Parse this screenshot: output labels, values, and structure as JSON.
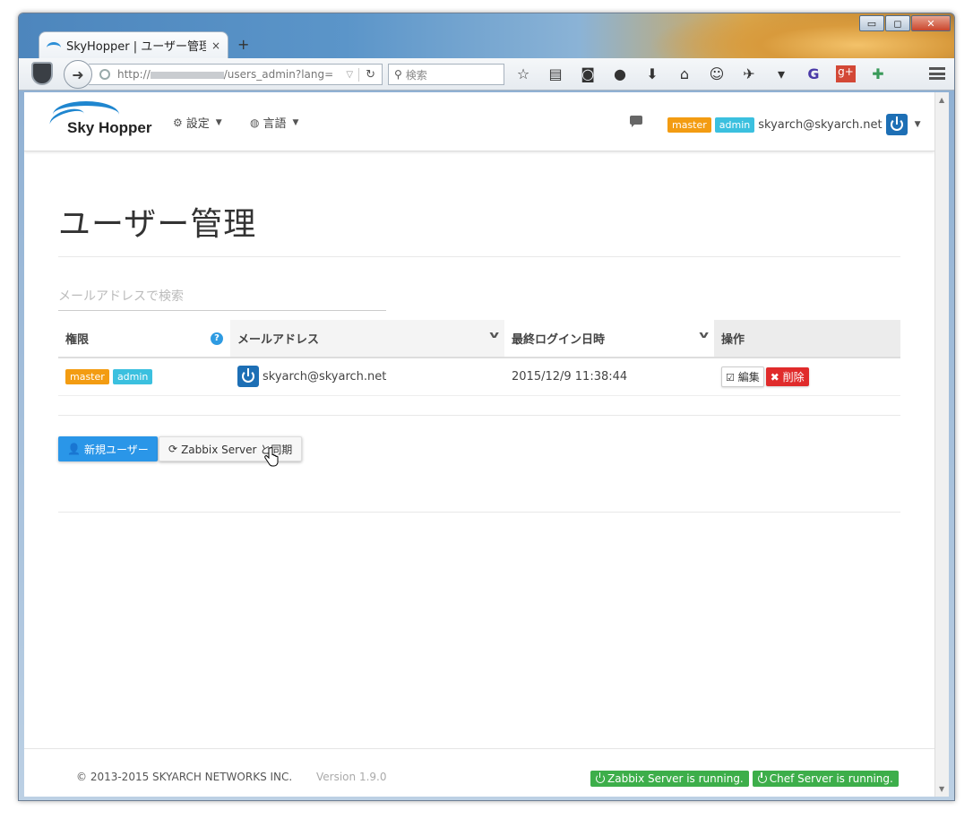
{
  "browser": {
    "tab_title": "SkyHopper | ユーザー管理",
    "tab_close": "×",
    "new_tab": "+",
    "url_prefix": "http://",
    "url_suffix": "/users_admin?lang=",
    "search_placeholder": "検索",
    "window_min": "▭",
    "window_max": "◻",
    "window_close": "✕"
  },
  "app_nav": {
    "logo_text": "Sky Hopper",
    "settings_label": "設定",
    "language_label": "言語",
    "user_email": "skyarch@skyarch.net",
    "badges": {
      "master": "master",
      "admin": "admin"
    }
  },
  "page": {
    "title": "ユーザー管理",
    "search_placeholder": "メールアドレスで検索"
  },
  "table": {
    "headers": {
      "role": "権限",
      "email": "メールアドレス",
      "last_login": "最終ログイン日時",
      "actions": "操作"
    },
    "rows": [
      {
        "badges": [
          "master",
          "admin"
        ],
        "email": "skyarch@skyarch.net",
        "last_login": "2015/12/9 11:38:44",
        "edit_label": "編集",
        "delete_label": "削除"
      }
    ]
  },
  "buttons": {
    "new_user": "新規ユーザー",
    "sync_zabbix": "Zabbix Server と同期"
  },
  "footer": {
    "copyright": "© 2013-2015 SKYARCH NETWORKS INC.",
    "version": "Version 1.9.0",
    "zabbix_status": "Zabbix Server is running.",
    "chef_status": "Chef Server is running."
  },
  "colors": {
    "brand_blue": "#1f86cf",
    "master_badge": "#f39c12",
    "admin_badge": "#3bc0df",
    "primary_button": "#2a96e8",
    "danger_button": "#e02b2b",
    "status_green": "#3dae4a"
  }
}
